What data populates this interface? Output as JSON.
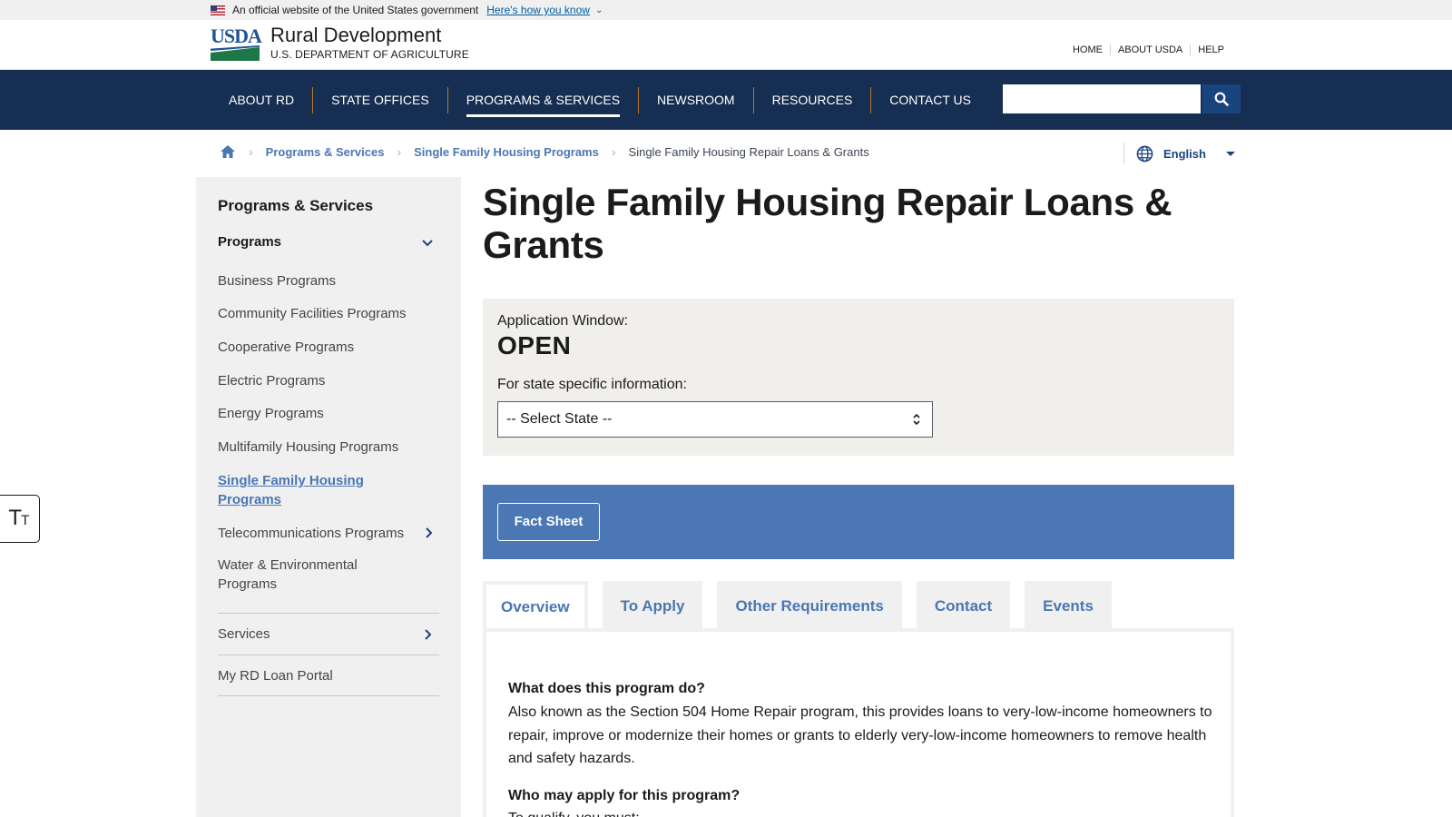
{
  "gov_banner": {
    "text": "An official website of the United States government",
    "link": "Here's how you know"
  },
  "header": {
    "logo_text": "USDA",
    "agency": "Rural Development",
    "department": "U.S. DEPARTMENT OF AGRICULTURE",
    "util_nav": [
      "HOME",
      "ABOUT USDA",
      "HELP"
    ]
  },
  "main_nav": {
    "items": [
      "ABOUT RD",
      "STATE OFFICES",
      "PROGRAMS & SERVICES",
      "NEWSROOM",
      "RESOURCES",
      "CONTACT US"
    ],
    "active": "PROGRAMS & SERVICES",
    "search_value": "",
    "search_icon": "search-icon"
  },
  "breadcrumb": {
    "home_icon": "home-icon",
    "items": [
      "Programs & Services",
      "Single Family Housing Programs"
    ],
    "current": "Single Family Housing Repair Loans & Grants"
  },
  "language": {
    "icon": "globe-icon",
    "selected": "English"
  },
  "sidebar": {
    "title": "Programs & Services",
    "section": "Programs",
    "programs": [
      "Business Programs",
      "Community Facilities Programs",
      "Cooperative Programs",
      "Electric Programs",
      "Energy Programs",
      "Multifamily Housing Programs",
      "Single Family Housing Programs",
      "Telecommunications Programs",
      "Water & Environmental Programs"
    ],
    "active_program": "Single Family Housing Programs",
    "services": "Services",
    "portal": "My RD Loan Portal"
  },
  "page": {
    "title": "Single Family Housing Repair Loans & Grants",
    "application_window_label": "Application Window:",
    "application_status": "OPEN",
    "state_info_label": "For state specific information:",
    "state_select_value": "-- Select State --",
    "fact_sheet": "Fact Sheet",
    "tabs": [
      "Overview",
      "To Apply",
      "Other Requirements",
      "Contact",
      "Events"
    ],
    "active_tab": "Overview",
    "overview": {
      "q1": "What does this program do?",
      "a1": "Also known as the Section 504 Home Repair program, this provides loans to very-low-income homeowners to repair, improve or modernize their homes or grants to elderly very-low-income homeowners to remove health and safety hazards.",
      "q2": "Who may apply for this program?",
      "a2": "To qualify, you must:"
    }
  },
  "colors": {
    "nav_bg": "#162e51",
    "link": "#4a77b4",
    "fact_bar": "#4b77b4",
    "sidebar_bg": "#f0f0f0",
    "app_box_bg": "#f0efec"
  }
}
